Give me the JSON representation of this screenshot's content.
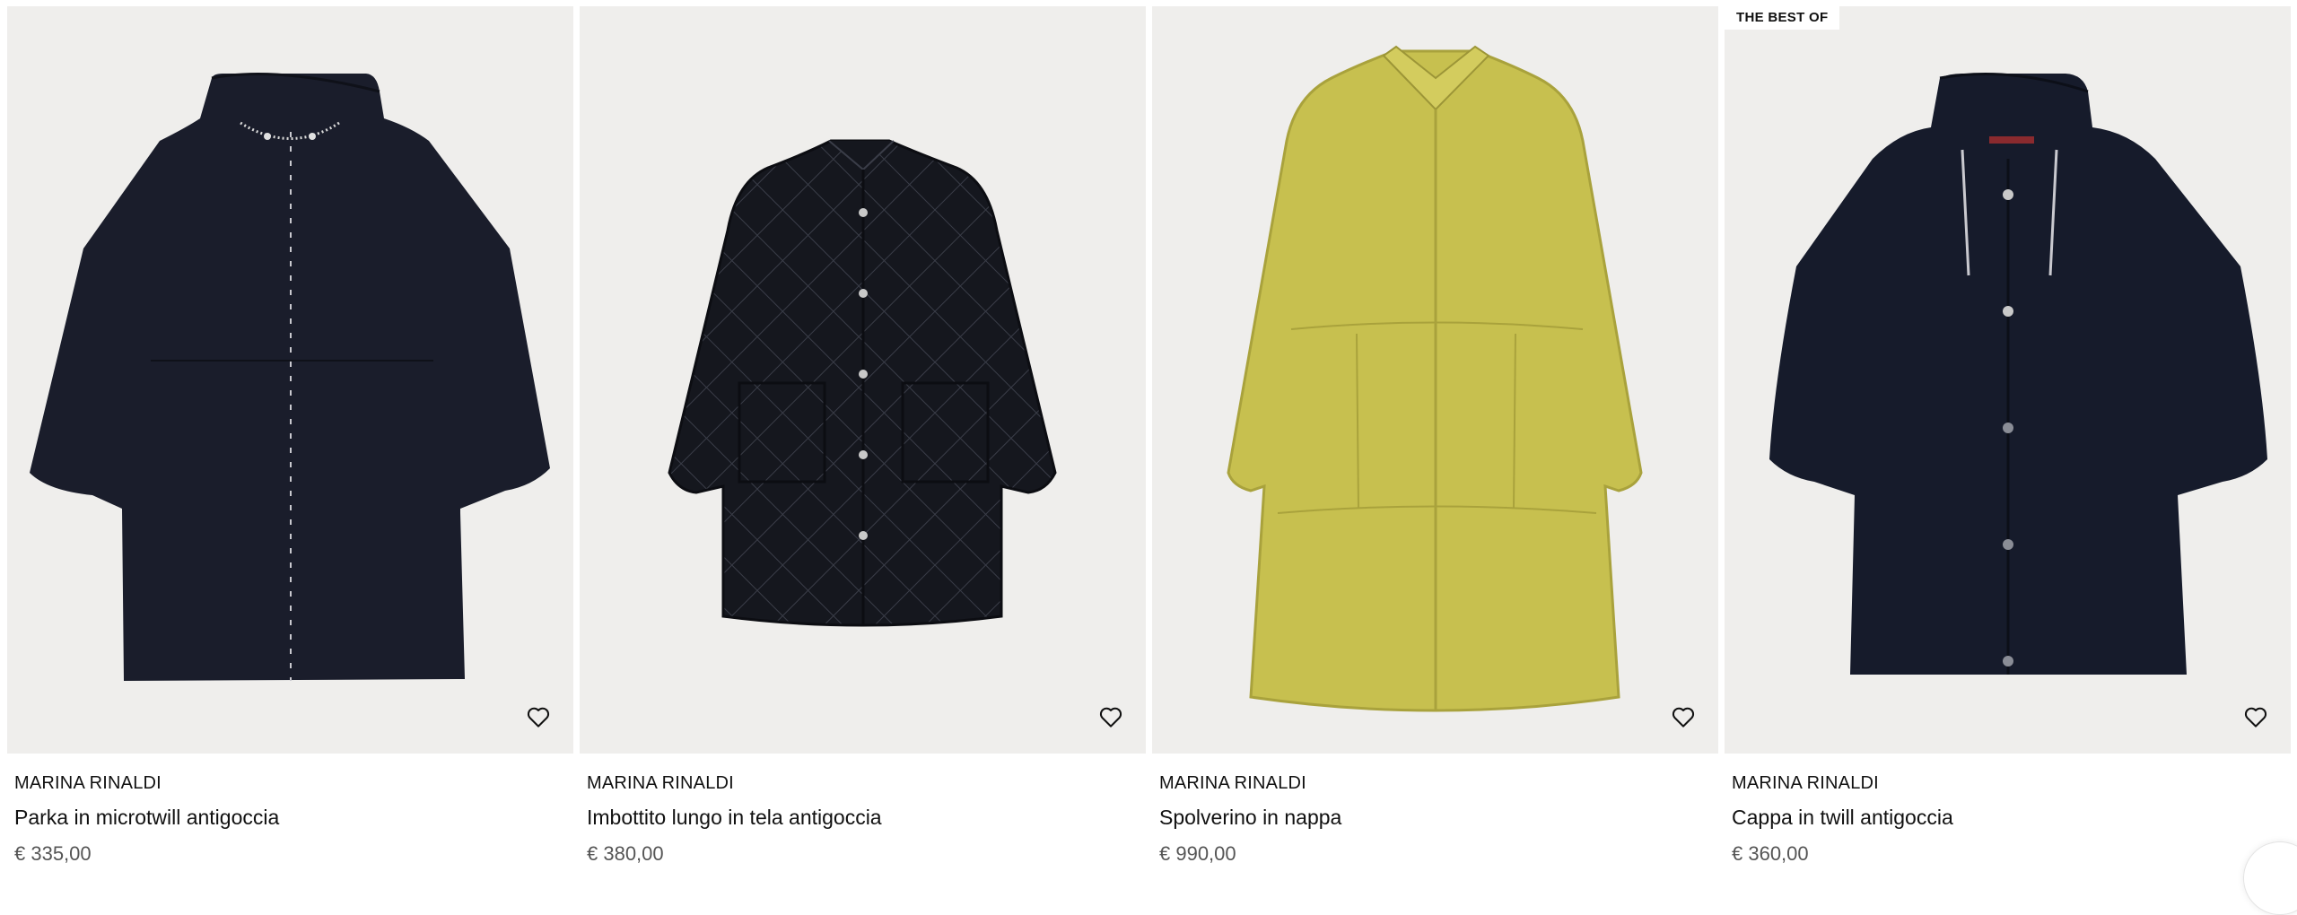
{
  "products": [
    {
      "brand": "MARINA RINALDI",
      "name": "Parka in microtwill antigoccia",
      "price": "€ 335,00",
      "badge": "",
      "garment_color": "#1a1d2b",
      "image_icon": "hooded-parka-image"
    },
    {
      "brand": "MARINA RINALDI",
      "name": "Imbottito lungo in tela antigoccia",
      "price": "€ 380,00",
      "badge": "",
      "garment_color": "#15171e",
      "image_icon": "quilted-jacket-image"
    },
    {
      "brand": "MARINA RINALDI",
      "name": "Spolverino in nappa",
      "price": "€ 990,00",
      "badge": "",
      "garment_color": "#c7c04f",
      "image_icon": "leather-coat-image"
    },
    {
      "brand": "MARINA RINALDI",
      "name": "Cappa in twill antigoccia",
      "price": "€ 360,00",
      "badge": "THE BEST OF",
      "garment_color": "#161b2b",
      "image_icon": "hooded-cape-image"
    }
  ],
  "wishlist_icon": "heart-outline-icon"
}
